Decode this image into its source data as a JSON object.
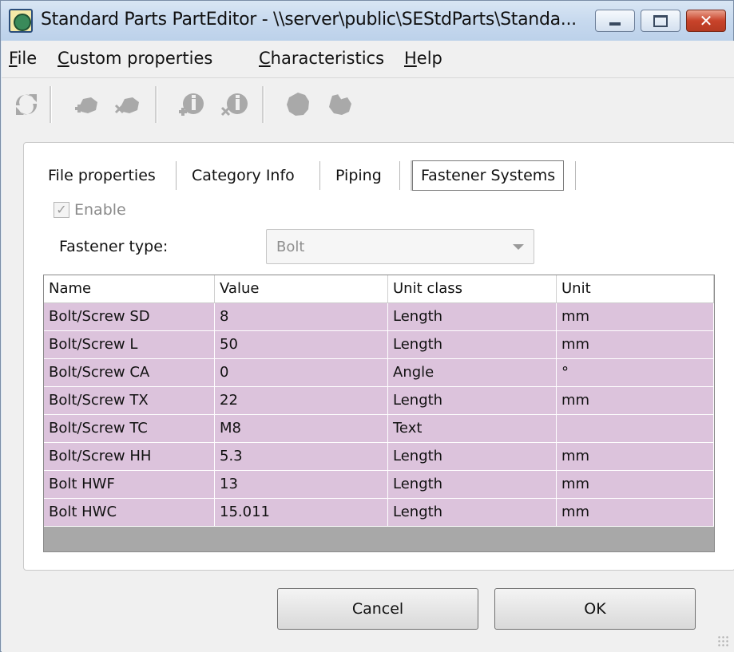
{
  "window": {
    "title": "Standard Parts PartEditor - \\\\server\\public\\SEStdParts\\Standa...",
    "controls": [
      "minimize-icon",
      "maximize-icon",
      "close-icon"
    ]
  },
  "menu": [
    {
      "id": "file",
      "underline": "F",
      "rest": "ile"
    },
    {
      "id": "custom-properties",
      "underline": "C",
      "rest": "ustom properties"
    },
    {
      "id": "characteristics",
      "underline": "C",
      "rest": "haracteristics"
    },
    {
      "id": "help",
      "underline": "H",
      "rest": "elp"
    }
  ],
  "toolbar": {
    "icons": [
      "refresh-icon",
      "add-part-icon",
      "remove-part-icon",
      "add-info-icon",
      "remove-info-icon",
      "circle-shape-icon",
      "multi-shape-icon"
    ],
    "state": "disabled"
  },
  "tabs": [
    {
      "label": "File properties",
      "active": false
    },
    {
      "label": "Category Info",
      "active": false
    },
    {
      "label": "Piping",
      "active": false
    },
    {
      "label": "Fastener Systems",
      "active": true
    }
  ],
  "enable": {
    "label": "Enable",
    "checked": true,
    "disabled": true
  },
  "fastener_type": {
    "label": "Fastener type:",
    "value": "Bolt"
  },
  "table": {
    "columns": [
      "Name",
      "Value",
      "Unit class",
      "Unit"
    ],
    "rows": [
      [
        "Bolt/Screw  SD",
        "8",
        "Length",
        "mm"
      ],
      [
        "Bolt/Screw  L",
        "50",
        "Length",
        "mm"
      ],
      [
        "Bolt/Screw  CA",
        "0",
        "Angle",
        "°"
      ],
      [
        "Bolt/Screw  TX",
        "22",
        "Length",
        "mm"
      ],
      [
        "Bolt/Screw  TC",
        "M8",
        "Text",
        ""
      ],
      [
        "Bolt/Screw  HH",
        "5.3",
        "Length",
        "mm"
      ],
      [
        "Bolt HWF",
        "13",
        "Length",
        "mm"
      ],
      [
        "Bolt HWC",
        "15.011",
        "Length",
        "mm"
      ]
    ]
  },
  "buttons": {
    "cancel": "Cancel",
    "ok": "OK"
  },
  "colors": {
    "row_background": "#dcc3dc",
    "title_gradient": "#c7d9ee",
    "close_button": "#c8432a"
  }
}
